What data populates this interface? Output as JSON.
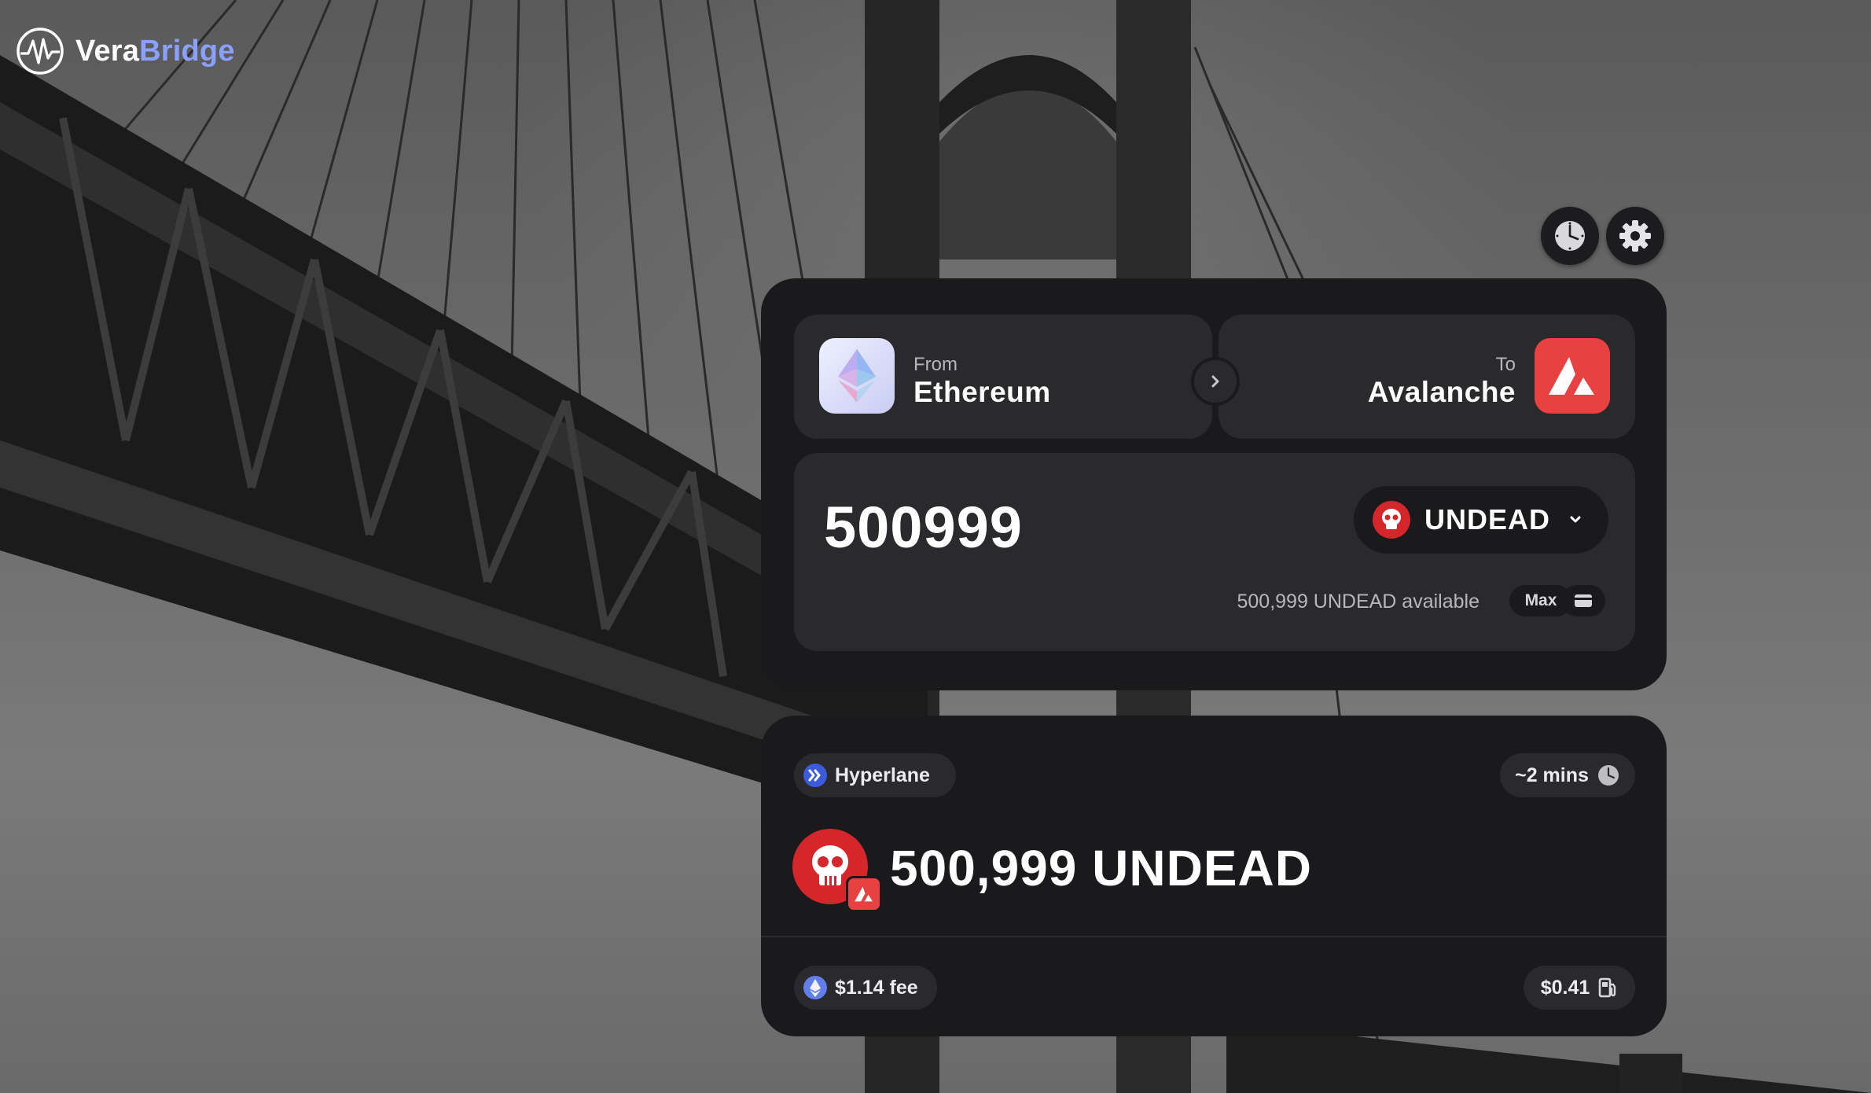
{
  "brand": {
    "name_part1": "Vera",
    "name_part2": "Bridge",
    "accent": "#8aa0ff"
  },
  "header_actions": {
    "history_icon": "clock-icon",
    "settings_icon": "gear-icon"
  },
  "transfer": {
    "from": {
      "label": "From",
      "chain": "Ethereum",
      "icon": "ethereum-icon"
    },
    "swap_icon": "chevron-right-icon",
    "to": {
      "label": "To",
      "chain": "Avalanche",
      "icon": "avalanche-icon",
      "color": "#e84142"
    },
    "amount": "500999",
    "token": {
      "symbol": "UNDEAD",
      "icon": "skull-icon",
      "color": "#d4262b"
    },
    "available_text": "500,999 UNDEAD available",
    "max_label": "Max"
  },
  "quote": {
    "route": "Hyperlane",
    "eta": "~2 mins",
    "receive": "500,999 UNDEAD",
    "fee": "$1.14 fee",
    "gas": "$0.41"
  }
}
